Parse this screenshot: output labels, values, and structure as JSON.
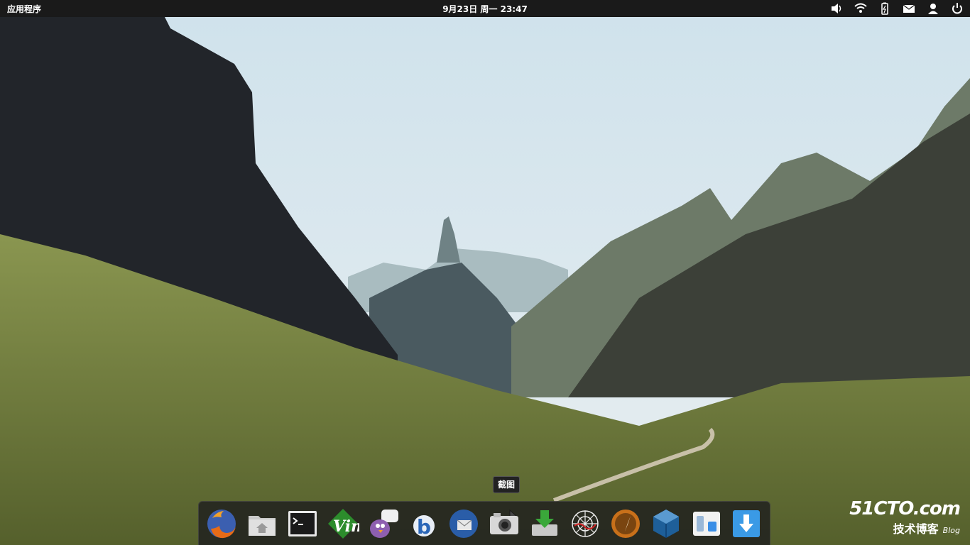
{
  "top_panel": {
    "applications_label": "应用程序",
    "clock": "9月23日 周一 23:47",
    "tray_icons": [
      "volume-icon",
      "wifi-icon",
      "battery-icon",
      "mail-icon",
      "user-icon",
      "power-icon"
    ]
  },
  "tooltip": {
    "text": "截图"
  },
  "dock": {
    "items": [
      {
        "name": "firefox-icon"
      },
      {
        "name": "home-folder-icon"
      },
      {
        "name": "terminal-icon"
      },
      {
        "name": "vim-icon"
      },
      {
        "name": "pidgin-icon"
      },
      {
        "name": "bluefish-icon"
      },
      {
        "name": "thunderbird-icon"
      },
      {
        "name": "screenshot-camera-icon"
      },
      {
        "name": "installer-icon"
      },
      {
        "name": "network-spider-icon"
      },
      {
        "name": "compass-icon"
      },
      {
        "name": "virtualbox-icon"
      },
      {
        "name": "switchboard-icon"
      },
      {
        "name": "download-icon"
      }
    ]
  },
  "watermark": {
    "brand": "51CTO.com",
    "subtitle": "技术博客",
    "blog": "Blog"
  },
  "colors": {
    "panel": "#1a1a1a",
    "dock": "#1e1e1e",
    "accent": "#3a8ee6"
  }
}
